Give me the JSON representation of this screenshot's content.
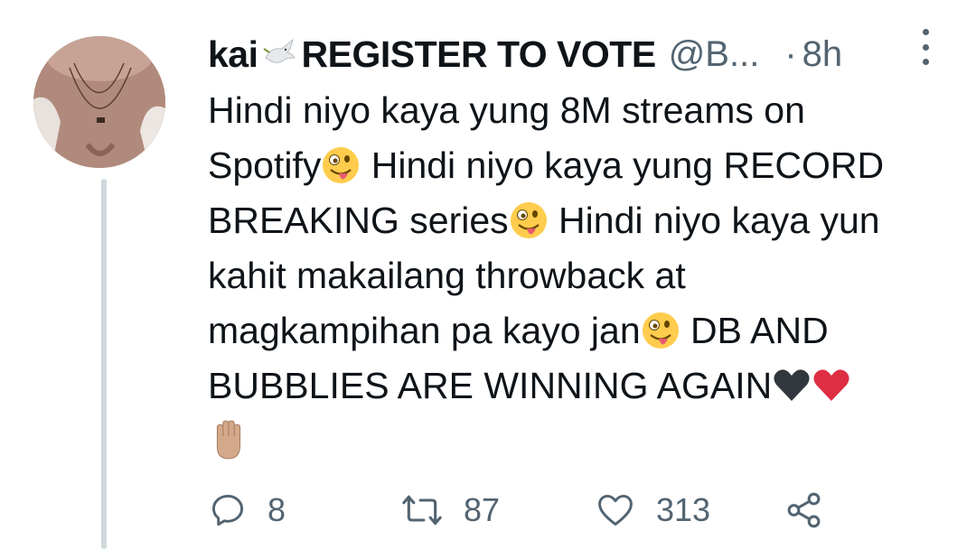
{
  "tweet": {
    "display_name": "kai",
    "display_name_suffix": "REGISTER TO VOTE",
    "handle": "@B...",
    "separator": "·",
    "time": "8h",
    "lines": [
      {
        "text": "Hindi niyo kaya yung 8M streams on",
        "emoji": null
      },
      {
        "text": "Spotify",
        "emoji": "zany-face",
        "after": " Hindi niyo kaya yung RECORD"
      },
      {
        "text": "BREAKING series",
        "emoji": "zany-face",
        "after": " Hindi niyo kaya yun"
      },
      {
        "text": "kahit makailang throwback at",
        "emoji": null
      },
      {
        "text": "magkampihan pa kayo jan",
        "emoji": "zany-face",
        "after": " DB AND"
      },
      {
        "text": "BUBBLIES ARE WINNING AGAIN",
        "emoji": "black-heart"
      }
    ],
    "icons": {
      "name_emoji": "dove-icon",
      "trailing_emoji": "raised-hand-icon",
      "red_heart": "red-heart-icon"
    }
  },
  "actions": {
    "reply_count": "8",
    "retweet_count": "87",
    "like_count": "313"
  },
  "colors": {
    "text": "#0f1419",
    "secondary": "#536471",
    "thread_line": "#cfd9de"
  }
}
